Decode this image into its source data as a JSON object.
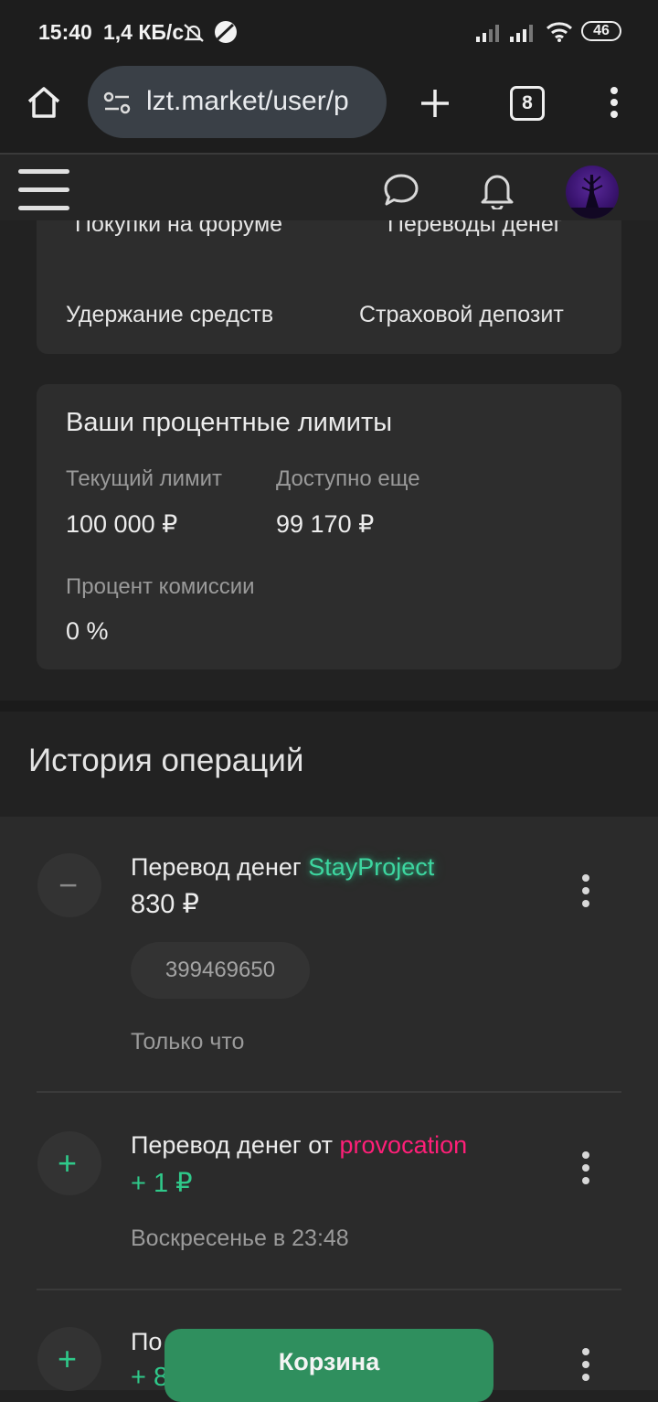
{
  "status_bar": {
    "time": "15:40",
    "net_speed": "1,4 КБ/с",
    "battery": "46",
    "icons": [
      "mute-bell-icon",
      "vpn-icon",
      "signal-icon",
      "signal-icon",
      "wifi-icon",
      "battery-icon"
    ]
  },
  "browser": {
    "url": "lzt.market/user/p",
    "tab_count": "8",
    "icons": [
      "home-icon",
      "site-settings-icon",
      "new-tab-icon",
      "tabs-icon",
      "more-icon"
    ]
  },
  "site_header": {
    "icons": [
      "menu-icon",
      "chat-icon",
      "bell-icon",
      "avatar"
    ]
  },
  "nav_links": {
    "partial_left": "Покупки на форуме",
    "partial_right": "Переводы денег",
    "hold": "Удержание средств",
    "deposit": "Страховой депозит"
  },
  "limits": {
    "title": "Ваши процентные лимиты",
    "current_label": "Текущий лимит",
    "current_value": "100 000 ₽",
    "available_label": "Доступно еще",
    "available_value": "99 170 ₽",
    "commission_label": "Процент комиссии",
    "commission_value": "0 %"
  },
  "history": {
    "title": "История операций",
    "operations": [
      {
        "sign": "−",
        "title_prefix": "Перевод денег",
        "user": "StayProject",
        "amount": "830 ₽",
        "id": "399469650",
        "time": "Только что"
      },
      {
        "sign": "+",
        "title_prefix": "Перевод денег от",
        "user": "provocation",
        "amount": "+ 1 ₽",
        "time": "Воскресенье в 23:48"
      },
      {
        "sign": "+",
        "title_prefix": "По",
        "amount": "+ 8"
      }
    ]
  },
  "cart_button": "Корзина",
  "colors": {
    "positive": "#2fc98a",
    "negative_sign": "#8a8a8a",
    "user_green": "#3dd6a0",
    "user_pink": "#ff1f78",
    "cart": "#2f8f5e"
  }
}
